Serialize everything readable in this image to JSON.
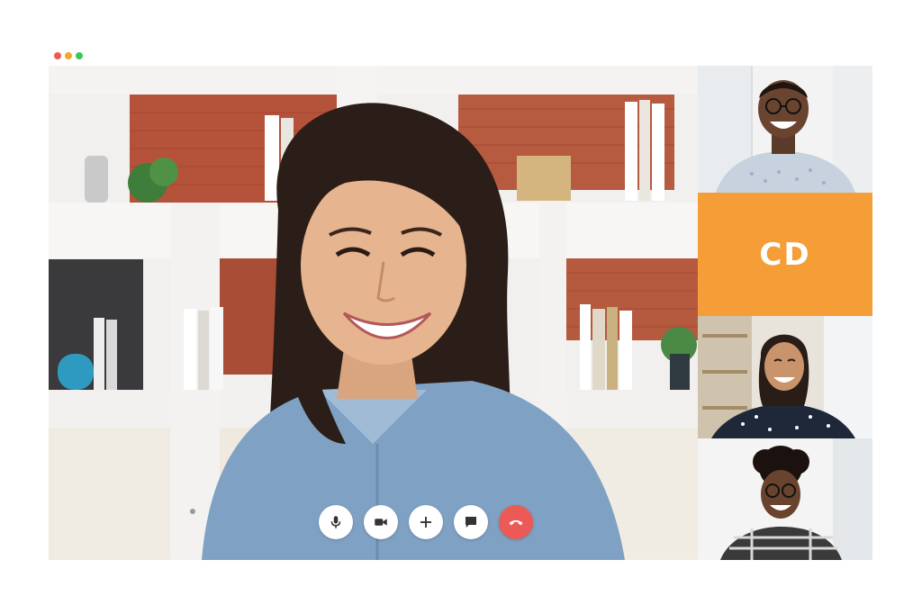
{
  "window_controls": {
    "dots": [
      {
        "name": "close-dot",
        "color": "#ee5a52"
      },
      {
        "name": "minimize-dot",
        "color": "#f5a623"
      },
      {
        "name": "maximize-dot",
        "color": "#3cc55a"
      }
    ]
  },
  "main_participant": {
    "video": "woman-smiling-denim-shirt-bookshelf-background"
  },
  "participants": [
    {
      "type": "video",
      "video": "man-smiling-glasses-patterned-shirt"
    },
    {
      "type": "initials",
      "initials": "CD",
      "color": "#f59e38"
    },
    {
      "type": "video",
      "video": "woman-smiling-polka-dot-blouse"
    },
    {
      "type": "video",
      "video": "woman-smiling-glasses-plaid-shirt"
    }
  ],
  "controls": [
    {
      "name": "microphone",
      "icon": "mic-icon"
    },
    {
      "name": "camera",
      "icon": "video-camera-icon"
    },
    {
      "name": "add",
      "icon": "plus-icon"
    },
    {
      "name": "chat",
      "icon": "chat-bubble-icon"
    },
    {
      "name": "end-call",
      "icon": "phone-hangup-icon",
      "color": "#ec5a55"
    }
  ]
}
